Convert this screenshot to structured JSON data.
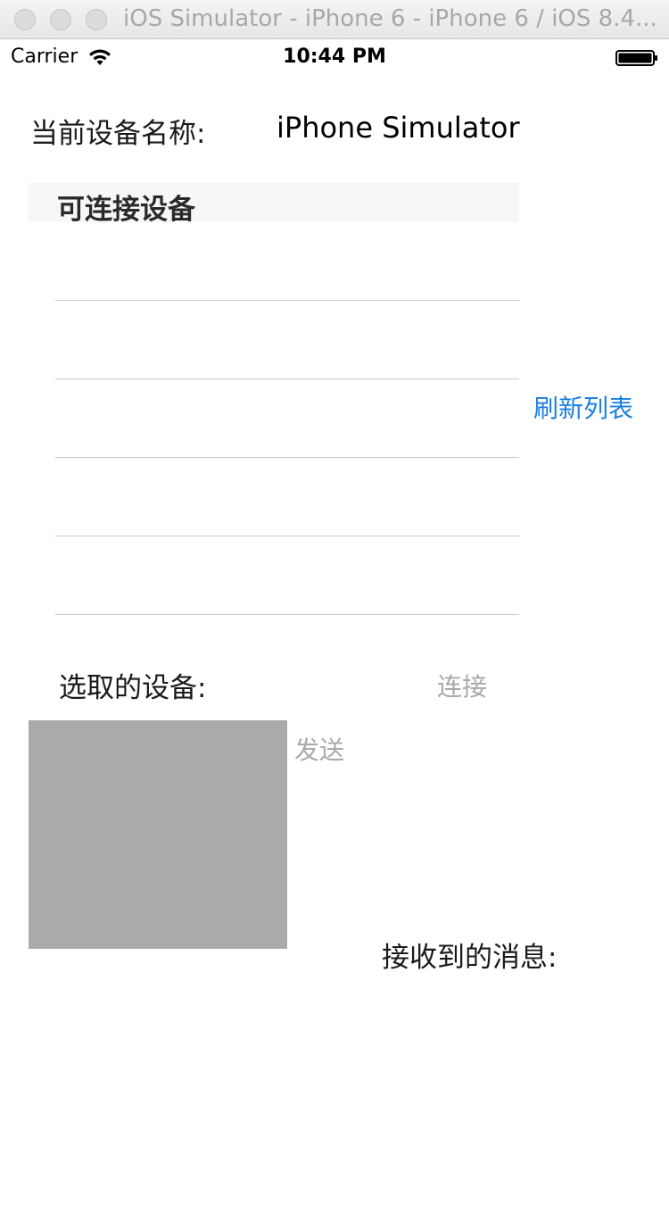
{
  "window": {
    "title": "iOS Simulator - iPhone 6 - iPhone 6 / iOS 8.4..."
  },
  "status_bar": {
    "carrier": "Carrier",
    "time": "10:44 PM"
  },
  "device": {
    "name_label": "当前设备名称:",
    "name_value": "iPhone Simulator"
  },
  "devices_table": {
    "header": "可连接设备",
    "rows": [
      "",
      "",
      "",
      "",
      ""
    ]
  },
  "actions": {
    "refresh_label": "刷新列表",
    "connect_label": "连接",
    "send_label": "发送"
  },
  "selection": {
    "selected_label": "选取的设备:"
  },
  "messages": {
    "received_label": "接收到的消息:"
  },
  "colors": {
    "accent": "#1a7fe0",
    "disabled": "#a9a9a9",
    "message_box": "#aaaaaa",
    "table_header_bg": "#f7f7f7"
  },
  "icons": {
    "wifi": "wifi-icon",
    "battery": "battery-icon"
  }
}
